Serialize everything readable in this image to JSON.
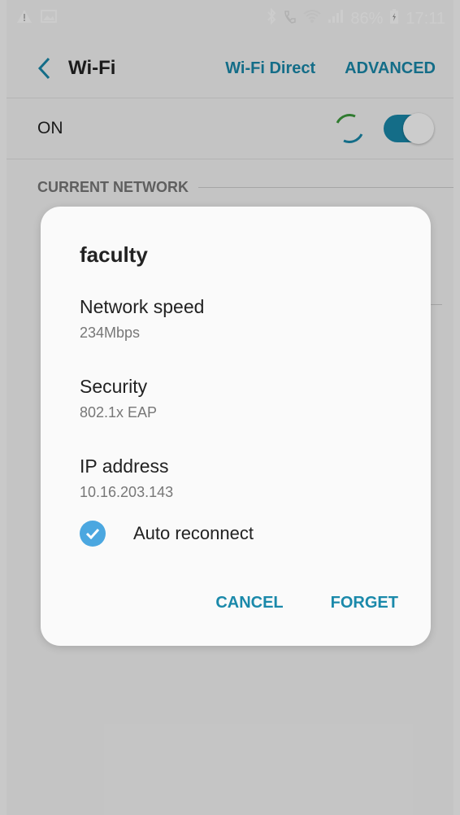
{
  "status_bar": {
    "battery": "86%",
    "time": "17:11",
    "icons": [
      "warning-icon",
      "image-icon",
      "bluetooth-icon",
      "wifi-calling-icon",
      "wifi-icon",
      "signal-icon",
      "battery-charging-icon"
    ]
  },
  "app_bar": {
    "title": "Wi-Fi",
    "actions": [
      "Wi-Fi Direct",
      "ADVANCED"
    ]
  },
  "wifi_toggle": {
    "label": "ON",
    "state": "on"
  },
  "sections": {
    "current_network": "CURRENT NETWORK"
  },
  "dialog": {
    "title": "faculty",
    "fields": [
      {
        "label": "Network speed",
        "value": "234Mbps"
      },
      {
        "label": "Security",
        "value": "802.1x EAP"
      },
      {
        "label": "IP address",
        "value": "10.16.203.143"
      }
    ],
    "auto_reconnect": {
      "label": "Auto reconnect",
      "checked": true
    },
    "buttons": {
      "cancel": "CANCEL",
      "forget": "FORGET"
    }
  },
  "colors": {
    "accent": "#1a89aa",
    "checkbox": "#4ba7e0",
    "background": "#f6f6f6"
  }
}
